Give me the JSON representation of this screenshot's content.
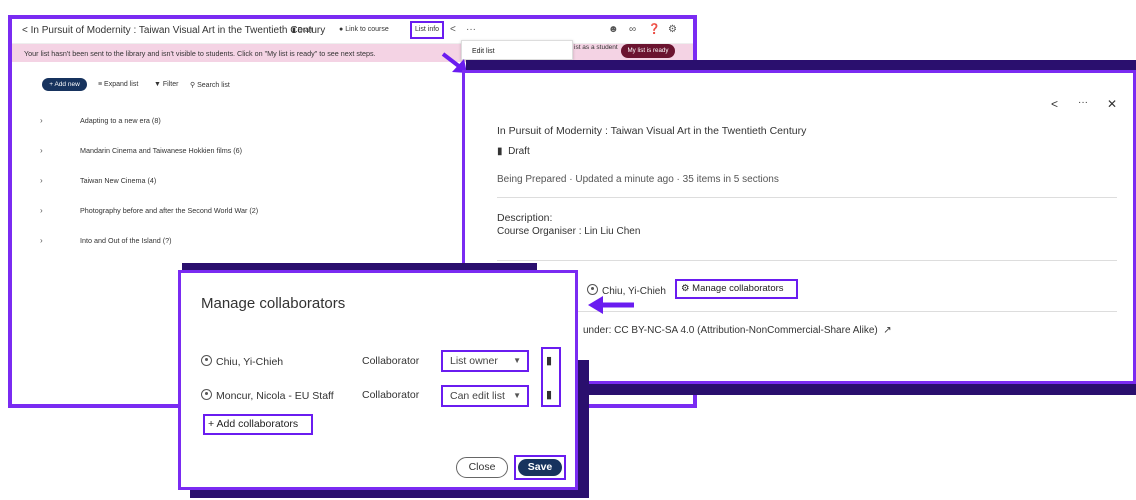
{
  "colors": {
    "highlight": "#6a1cf0",
    "primary_button": "#17335e",
    "banner_bg": "#f4d3e4",
    "ready_button": "#6b1430"
  },
  "main": {
    "title": "In Pursuit of Modernity : Taiwan Visual Art in the Twentieth Century",
    "draft_label": "Draft",
    "link_course_label": "Link to course",
    "list_info_label": "List info",
    "banner_text": "Your list hasn't been sent to the library and isn't visible to students. Click on \"My list is ready\" to see next steps.",
    "toolbar": {
      "add_new": "+ Add new",
      "expand": "Expand list",
      "filter": "Filter",
      "search": "Search list"
    },
    "sections": [
      "Adapting to a new era (8)",
      "Mandarin Cinema and Taiwanese Hokkien films (6)",
      "Taiwan New Cinema (4)",
      "Photography before and after the Second World War (2)",
      "Into and Out of the Island (?)"
    ]
  },
  "dropdown": {
    "edit_list": "Edit list"
  },
  "banner_right": {
    "view_text": "ist as a student",
    "ready_label": "My list is ready"
  },
  "info_panel": {
    "title": "In Pursuit of Modernity : Taiwan Visual Art in the Twentieth Century",
    "draft": "Draft",
    "meta": "Being Prepared · Updated a minute ago · 35 items in 5 sections",
    "description_label": "Description:",
    "description": "Course Organiser : Lin Liu Chen",
    "owner": "Chiu, Yi-Chieh",
    "manage_collaborators": "Manage collaborators",
    "license": "under: CC BY-NC-SA 4.0 (Attribution-NonCommercial-Share Alike)"
  },
  "modal": {
    "title": "Manage collaborators",
    "collaborators": [
      {
        "name": "Chiu, Yi-Chieh",
        "role": "Collaborator",
        "permission": "List owner"
      },
      {
        "name": "Moncur, Nicola - EU Staff",
        "role": "Collaborator",
        "permission": "Can edit list"
      }
    ],
    "add_collaborators": "+ Add collaborators",
    "close": "Close",
    "save": "Save"
  }
}
